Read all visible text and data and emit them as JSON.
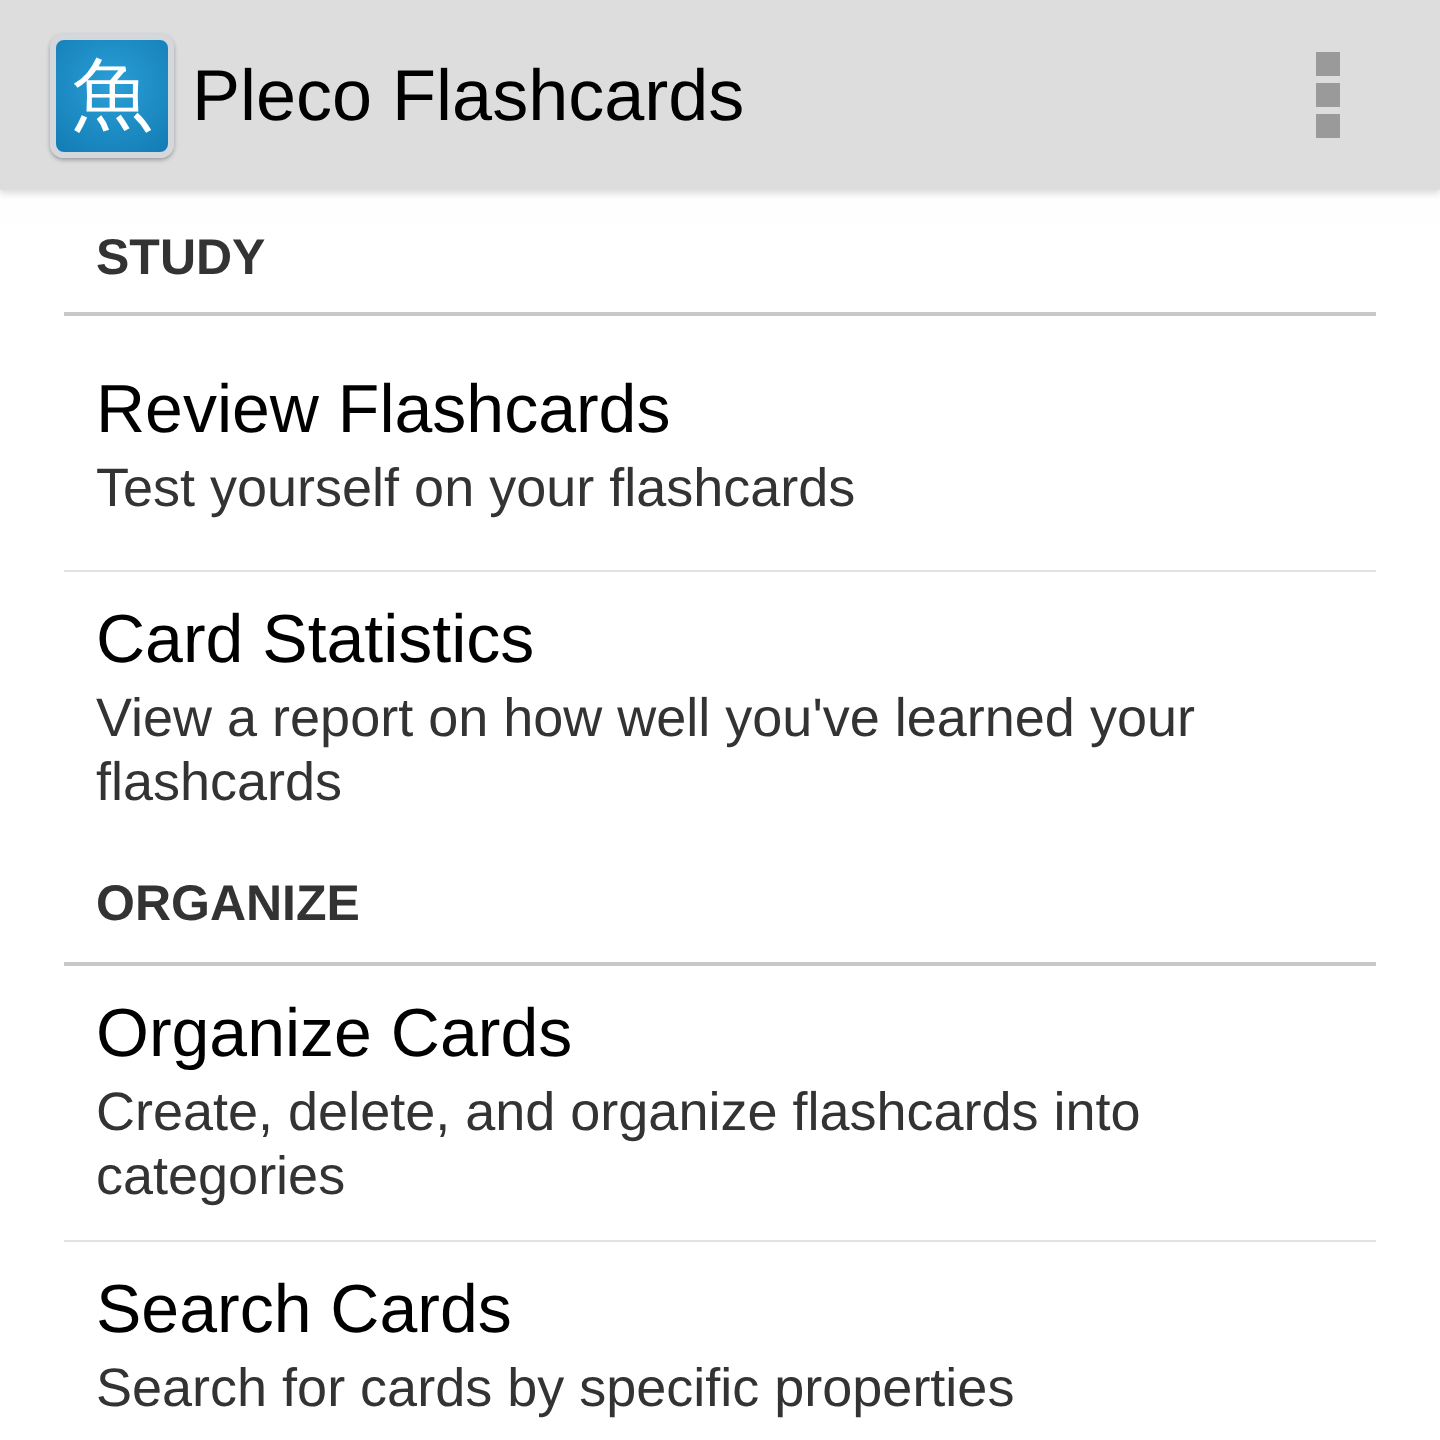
{
  "app_bar": {
    "icon_glyph": "魚",
    "title": "Pleco Flashcards"
  },
  "sections": [
    {
      "header": "STUDY",
      "items": [
        {
          "title": "Review Flashcards",
          "subtitle": "Test yourself on your flashcards"
        },
        {
          "title": "Card Statistics",
          "subtitle": "View a report on how well you've learned your flashcards"
        }
      ]
    },
    {
      "header": "ORGANIZE",
      "items": [
        {
          "title": "Organize Cards",
          "subtitle": "Create, delete, and organize flashcards into categories"
        },
        {
          "title": "Search Cards",
          "subtitle": "Search for cards by specific properties"
        }
      ]
    }
  ]
}
